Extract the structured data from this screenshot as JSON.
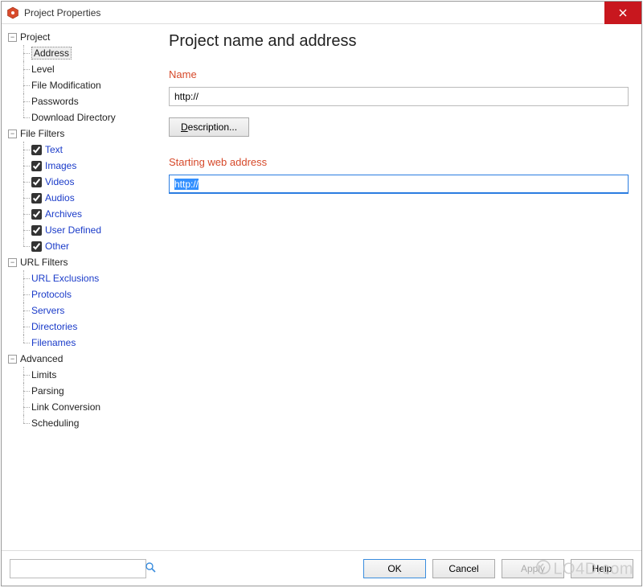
{
  "window": {
    "title": "Project Properties"
  },
  "tree": {
    "project": {
      "label": "Project",
      "items": {
        "address": "Address",
        "level": "Level",
        "file_mod": "File Modification",
        "passwords": "Passwords",
        "download_dir": "Download Directory"
      }
    },
    "file_filters": {
      "label": "File Filters",
      "items": {
        "text": "Text",
        "images": "Images",
        "videos": "Videos",
        "audios": "Audios",
        "archives": "Archives",
        "user_defined": "User Defined",
        "other": "Other"
      }
    },
    "url_filters": {
      "label": "URL Filters",
      "items": {
        "exclusions": "URL Exclusions",
        "protocols": "Protocols",
        "servers": "Servers",
        "directories": "Directories",
        "filenames": "Filenames"
      }
    },
    "advanced": {
      "label": "Advanced",
      "items": {
        "limits": "Limits",
        "parsing": "Parsing",
        "link_conv": "Link Conversion",
        "scheduling": "Scheduling"
      }
    }
  },
  "main": {
    "heading": "Project name and address",
    "name_label": "Name",
    "name_value": "http://",
    "description_btn": "escription...",
    "description_btn_hotkey": "D",
    "start_label": "Starting web address",
    "start_value": "http://"
  },
  "footer": {
    "search_placeholder": "",
    "ok": "OK",
    "cancel": "Cancel",
    "apply": "Apply",
    "help": "Help"
  },
  "watermark": "LO4D.com"
}
